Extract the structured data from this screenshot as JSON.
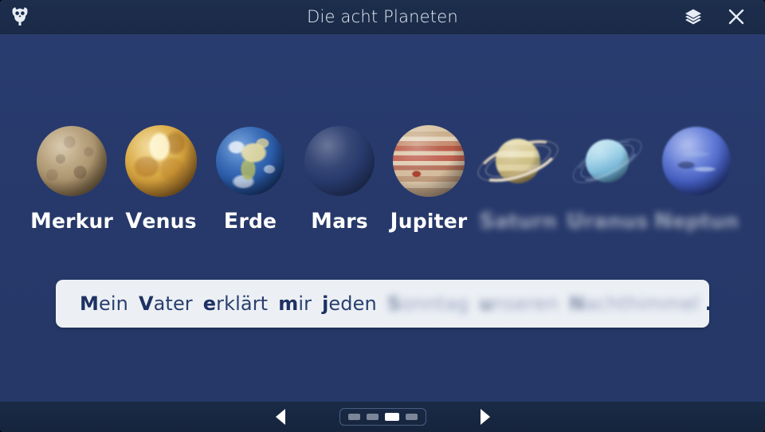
{
  "window": {
    "title": "Die acht Planeten",
    "logo_icon": "owl-logo-icon",
    "layers_icon": "layers-icon",
    "close_icon": "close-icon"
  },
  "planets": [
    {
      "label": "Merkur",
      "cap": "M",
      "rest": "erkur",
      "revealed": true,
      "body": "mercury"
    },
    {
      "label": "Venus",
      "cap": "V",
      "rest": "enus",
      "revealed": true,
      "body": "venus"
    },
    {
      "label": "Erde",
      "cap": "E",
      "rest": "rde",
      "revealed": true,
      "body": "earth"
    },
    {
      "label": "Mars",
      "cap": "M",
      "rest": "ars",
      "revealed": true,
      "body": "mars"
    },
    {
      "label": "Jupiter",
      "cap": "J",
      "rest": "upiter",
      "revealed": true,
      "body": "jupiter"
    },
    {
      "label": "Saturn",
      "cap": "S",
      "rest": "aturn",
      "revealed": false,
      "body": "saturn"
    },
    {
      "label": "Uranus",
      "cap": "U",
      "rest": "ranus",
      "revealed": false,
      "body": "uranus"
    },
    {
      "label": "Neptun",
      "cap": "N",
      "rest": "eptun",
      "revealed": false,
      "body": "neptune"
    }
  ],
  "sentence": {
    "words": [
      {
        "cap": "M",
        "rest": "ein",
        "revealed": true
      },
      {
        "cap": "V",
        "rest": "ater",
        "revealed": true
      },
      {
        "cap": "e",
        "rest": "rklärt",
        "revealed": true
      },
      {
        "cap": "m",
        "rest": "ir",
        "revealed": true
      },
      {
        "cap": "j",
        "rest": "eden",
        "revealed": true
      },
      {
        "cap": "S",
        "rest": "onntag",
        "revealed": false
      },
      {
        "cap": "u",
        "rest": "nseren",
        "revealed": false
      },
      {
        "cap": "N",
        "rest": "achthimmel",
        "revealed": false
      }
    ],
    "period": "."
  },
  "footer": {
    "prev_icon": "chevron-left-icon",
    "next_icon": "chevron-right-icon",
    "page_count": 4,
    "current_page": 3
  },
  "colors": {
    "background": "#27396b",
    "topbar": "#1b2c4a",
    "bottombar": "#17263f",
    "card": "#ecf0f5",
    "text_light": "#ffffff",
    "text_dark": "#2a3f6e",
    "accent": "#1e3163"
  }
}
